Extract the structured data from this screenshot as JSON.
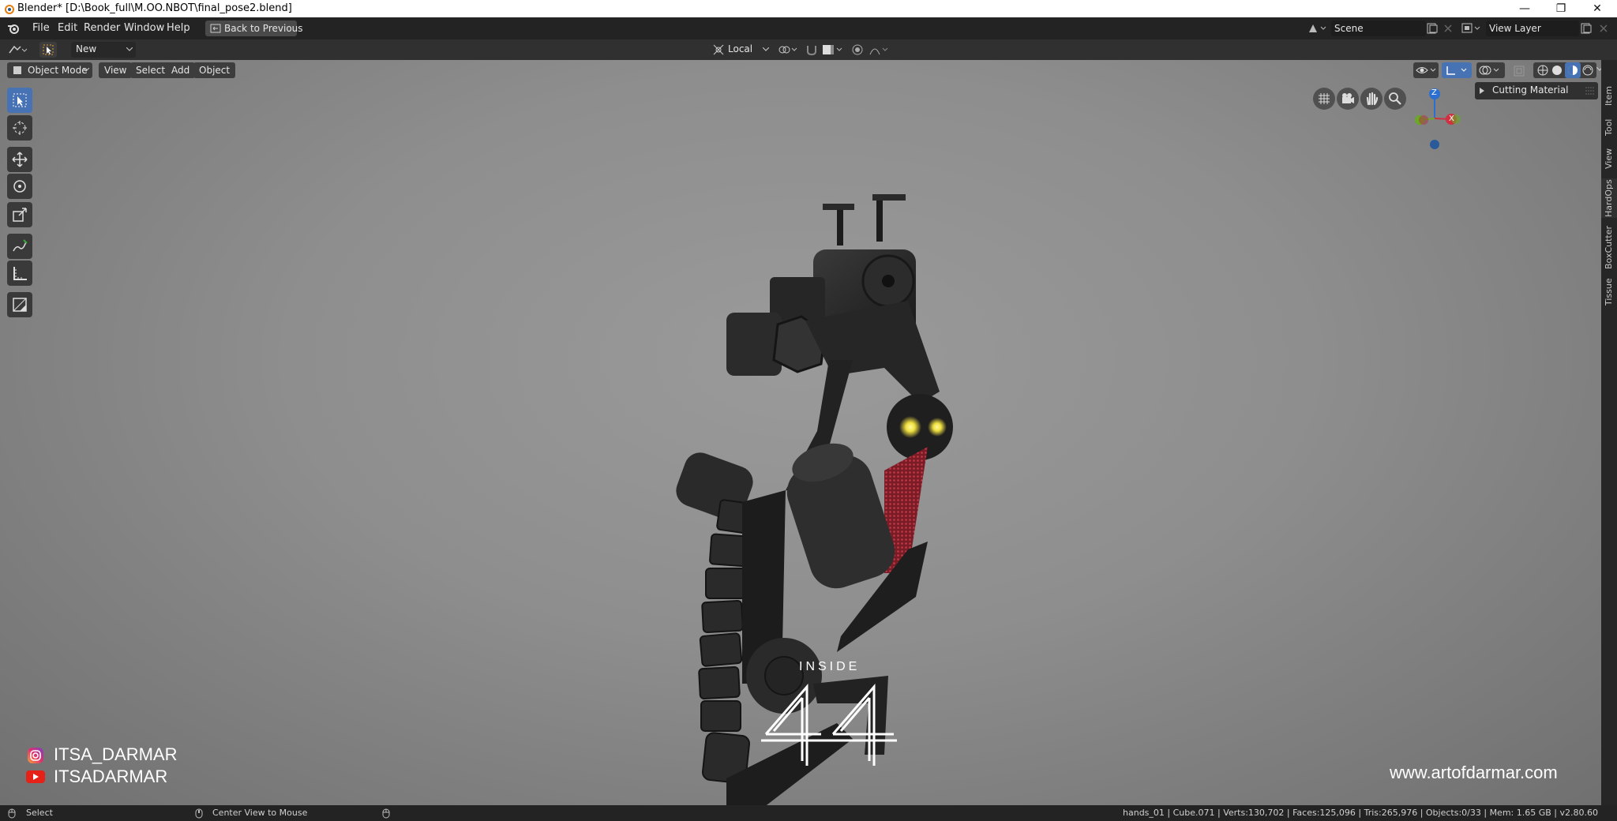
{
  "window": {
    "title": "Blender* [D:\\Book_full\\M.OO.NBOT\\final_pose2.blend]",
    "minimize": "—",
    "restore": "❐",
    "close": "✕"
  },
  "menubar": {
    "items": [
      "File",
      "Edit",
      "Render",
      "Window",
      "Help"
    ],
    "back_button": "Back to Previous",
    "scene": "Scene",
    "view_layer": "View Layer"
  },
  "toolheader": {
    "new_label": "New",
    "orientation": "Local"
  },
  "viewport_header": {
    "mode": "Object Mode",
    "menus": [
      "View",
      "Select",
      "Add",
      "Object"
    ]
  },
  "panel": {
    "cutting_material": "Cutting Material"
  },
  "side_tabs": [
    "Item",
    "Tool",
    "View",
    "HardOps",
    "BoxCutter",
    "Tissue"
  ],
  "gizmo": {
    "z": "Z",
    "x": "X"
  },
  "overlay": {
    "instagram": "ITSA_DARMAR",
    "youtube": "ITSADARMAR",
    "inside": "INSIDE",
    "logo_number": "44",
    "website": "www.artofdarmar.com"
  },
  "statusbar": {
    "select": "Select",
    "center_view": "Center View to Mouse",
    "stats": "hands_01 | Cube.071 | Verts:130,702 | Faces:125,096 | Tris:265,976 | Objects:0/33 | Mem: 1.65 GB | v2.80.60"
  },
  "colors": {
    "accent": "#4772b3",
    "robot_glow": "#f0e040",
    "robot_red": "#b02a35"
  }
}
